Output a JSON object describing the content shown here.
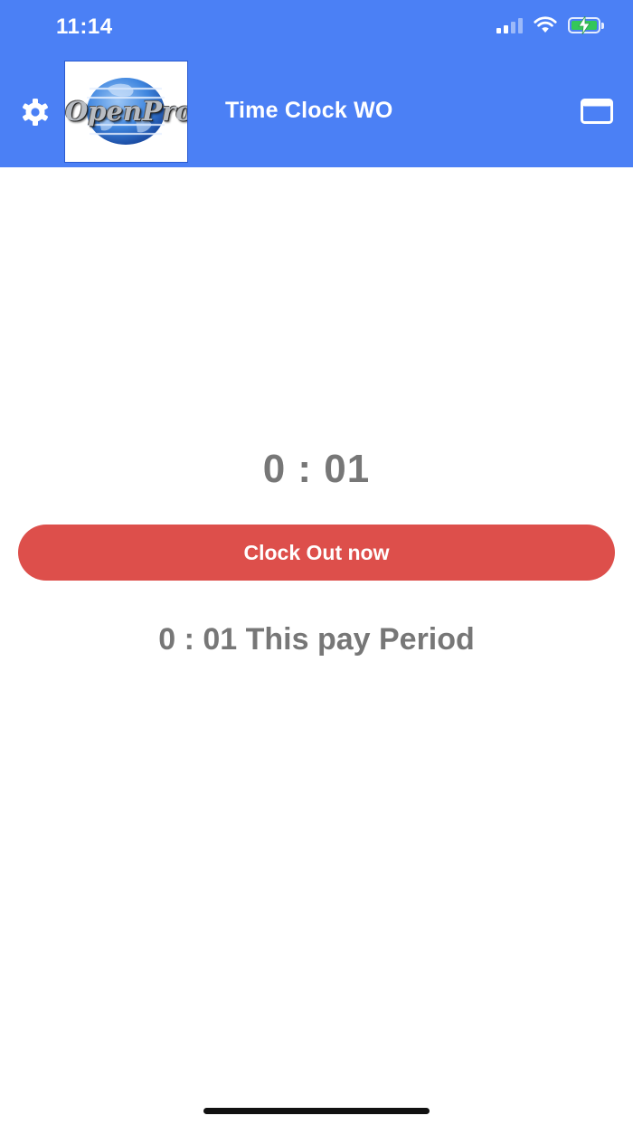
{
  "status_bar": {
    "time": "11:14",
    "icons": [
      "cellular-signal-icon",
      "wifi-icon",
      "battery-charging-icon"
    ],
    "battery_level": 0.9
  },
  "header": {
    "background_color": "#4b80f5",
    "title": "Time Clock WO",
    "logo_text": "OpenPro",
    "left_icon": "gear-icon",
    "right_icon": "calendar-icon"
  },
  "main": {
    "elapsed_time": "0 : 01",
    "clock_button_label": "Clock Out now",
    "clock_button_color": "#dd4f4b",
    "pay_period_summary": "0 : 01 This pay Period",
    "text_color": "#777777"
  }
}
